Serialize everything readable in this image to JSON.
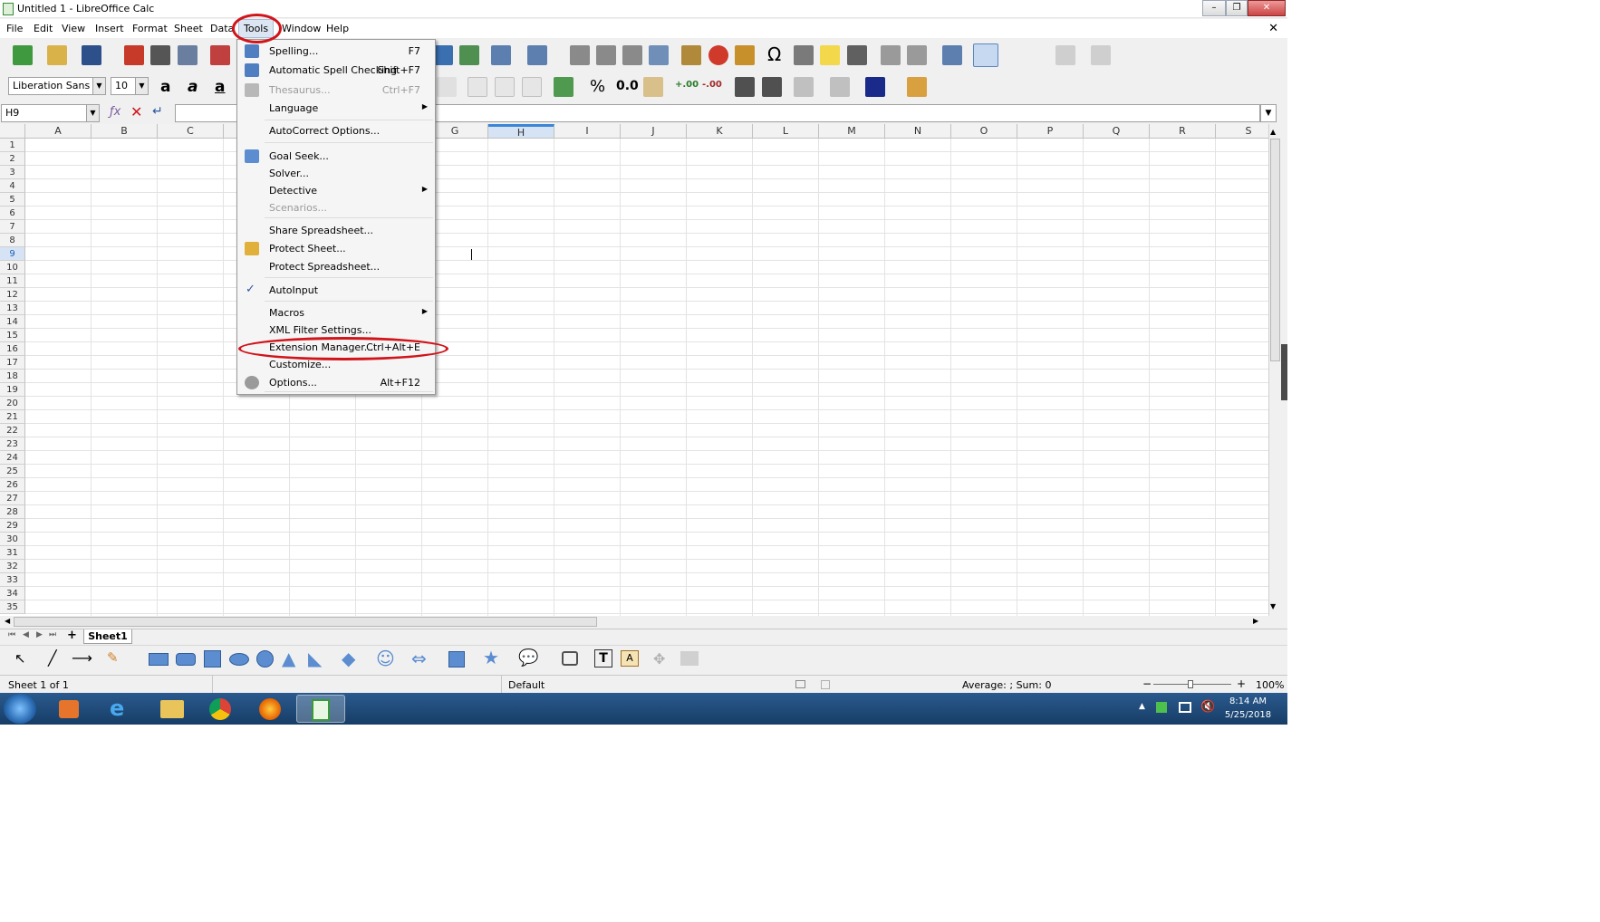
{
  "window": {
    "title": "Untitled 1 - LibreOffice Calc",
    "controls": {
      "minimize": "–",
      "maximize": "❐",
      "close": "✕"
    }
  },
  "menubar": {
    "items": [
      "File",
      "Edit",
      "View",
      "Insert",
      "Format",
      "Sheet",
      "Data",
      "Tools",
      "Window",
      "Help"
    ],
    "doc_close": "✕",
    "active": "Tools"
  },
  "format_toolbar": {
    "font_name": "Liberation Sans",
    "font_size": "10",
    "number_format_percent": "%",
    "number_format_decimal": "0.0",
    "add_decimal": "+.00",
    "remove_decimal": "-.00",
    "bold": "a",
    "italic": "a",
    "underline": "a"
  },
  "formula_bar": {
    "name_box": "H9",
    "formula": ""
  },
  "grid": {
    "columns": [
      "A",
      "B",
      "C",
      "D",
      "E",
      "F",
      "G",
      "H",
      "I",
      "J",
      "K",
      "L",
      "M",
      "N",
      "O",
      "P",
      "Q",
      "R",
      "S"
    ],
    "rows": [
      "1",
      "2",
      "3",
      "4",
      "5",
      "6",
      "7",
      "8",
      "9",
      "10",
      "11",
      "12",
      "13",
      "14",
      "15",
      "16",
      "17",
      "18",
      "19",
      "20",
      "21",
      "22",
      "23",
      "24",
      "25",
      "26",
      "27",
      "28",
      "29",
      "30",
      "31",
      "32",
      "33",
      "34",
      "35"
    ],
    "selected_column": "H",
    "selected_row": "9"
  },
  "tools_menu": {
    "items": [
      {
        "label": "Spelling...",
        "shortcut": "F7",
        "icon": "spelling-icon",
        "disabled": false
      },
      {
        "label": "Automatic Spell Checking",
        "shortcut": "Shift+F7",
        "icon": "auto-spellcheck-icon",
        "disabled": false
      },
      {
        "label": "Thesaurus...",
        "shortcut": "Ctrl+F7",
        "icon": "thesaurus-icon",
        "disabled": true
      },
      {
        "label": "Language",
        "submenu": true
      },
      {
        "label": "AutoCorrect Options..."
      },
      {
        "label": "Goal Seek...",
        "icon": "goal-seek-icon"
      },
      {
        "label": "Solver..."
      },
      {
        "label": "Detective",
        "submenu": true
      },
      {
        "label": "Scenarios...",
        "disabled": true
      },
      {
        "label": "Share Spreadsheet..."
      },
      {
        "label": "Protect Sheet...",
        "icon": "lock-icon"
      },
      {
        "label": "Protect Spreadsheet..."
      },
      {
        "label": "AutoInput",
        "checked": true
      },
      {
        "label": "Macros",
        "submenu": true
      },
      {
        "label": "XML Filter Settings..."
      },
      {
        "label": "Extension Manager...",
        "shortcut": "Ctrl+Alt+E",
        "highlighted": true
      },
      {
        "label": "Customize..."
      },
      {
        "label": "Options...",
        "shortcut": "Alt+F12",
        "icon": "gear-icon"
      }
    ],
    "submenu_arrow": "▶",
    "check_mark": "✓"
  },
  "sheet_tabs": {
    "add": "+",
    "tabs": [
      "Sheet1"
    ]
  },
  "status_bar": {
    "sheet_info": "Sheet 1 of 1",
    "page_style": "Default",
    "summary": "Average: ; Sum: 0",
    "zoom_minus": "−",
    "zoom_plus": "+",
    "zoom": "100%"
  },
  "taskbar": {
    "time": "8:14 AM",
    "date": "5/25/2018",
    "apps": [
      "windows-start-icon",
      "media-player-icon",
      "internet-explorer-icon",
      "file-explorer-icon",
      "chrome-icon",
      "firefox-icon",
      "libreoffice-calc-icon"
    ]
  },
  "colors": {
    "annotation": "#d1141a",
    "selection": "#3a86d6",
    "taskbar": "#1f4a78"
  }
}
